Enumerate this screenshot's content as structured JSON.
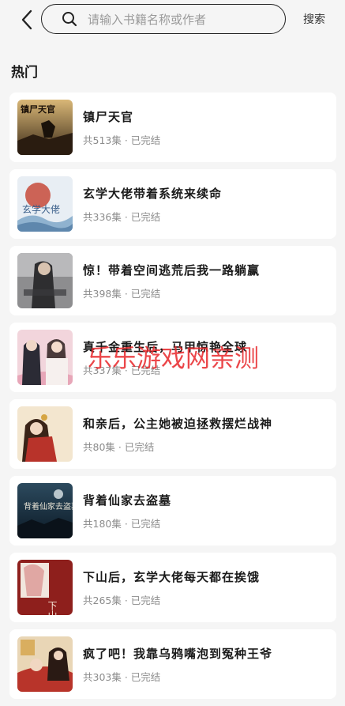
{
  "search": {
    "placeholder": "请输入书籍名称或作者",
    "button_label": "搜索"
  },
  "section": {
    "title": "热门"
  },
  "books": [
    {
      "title": "镇尸天官",
      "meta": "共513集 · 已完结",
      "cover_text": "镇尸天官"
    },
    {
      "title": "玄学大佬带着系统来续命",
      "meta": "共336集 · 已完结",
      "cover_text": "玄学大佬"
    },
    {
      "title": "惊！带着空间逃荒后我一路躺赢",
      "meta": "共398集 · 已完结",
      "cover_text": ""
    },
    {
      "title": "真千金重生后，马甲惊艳全球",
      "meta": "共337集 · 已完结",
      "cover_text": ""
    },
    {
      "title": "和亲后，公主她被迫拯救摆烂战神",
      "meta": "共80集 · 已完结",
      "cover_text": ""
    },
    {
      "title": "背着仙家去盗墓",
      "meta": "共180集 · 已完结",
      "cover_text": "背着仙家去盗墓"
    },
    {
      "title": "下山后，玄学大佬每天都在挨饿",
      "meta": "共265集 · 已完结",
      "cover_text": "下山后"
    },
    {
      "title": "疯了吧！我靠乌鸦嘴泡到冤种王爷",
      "meta": "共303集 · 已完结",
      "cover_text": ""
    }
  ],
  "watermark": "乐乐游戏网亲测",
  "colors": {
    "background": "#f5f5f5",
    "card": "#ffffff",
    "watermark": "#e8262a"
  }
}
